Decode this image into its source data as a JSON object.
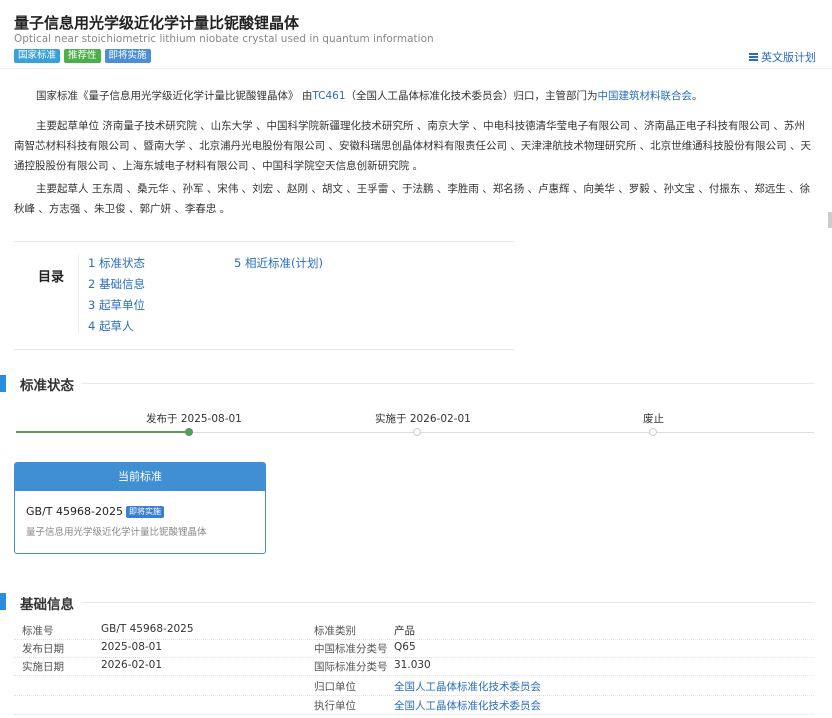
{
  "header": {
    "title_cn": "量子信息用光学级近化学计量比铌酸锂晶体",
    "title_en": "Optical near stoichiometric lithium niobate crystal used in quantum information",
    "tags": [
      "国家标准",
      "推荐性",
      "即将实施"
    ],
    "en_plan_label": "英文版计划"
  },
  "intro": {
    "p1_a": "国家标准《量子信息用光学级近化学计量比铌酸锂晶体》 由",
    "p1_tc": "TC461",
    "p1_b": "（全国人工晶体标准化技术委员会）归口，主管部门为",
    "p1_dept": "中国建筑材料联合会",
    "p1_c": "。",
    "p2": "主要起草单位 济南量子技术研究院 、山东大学 、中国科学院新疆理化技术研究所 、南京大学 、中电科技德清华莹电子有限公司 、济南晶正电子科技有限公司 、苏州南智芯材料科技有限公司 、暨南大学 、北京浦丹光电股份有限公司 、安徽科瑞思创晶体材料有限责任公司 、天津津航技术物理研究所 、北京世维通科技股份有限公司 、天通控股股份有限公司 、上海东城电子材料有限公司 、中国科学院空天信息创新研究院 。",
    "p3": "主要起草人 王东周 、桑元华 、孙军 、宋伟 、刘宏 、赵刚 、胡文 、王孚雷 、于法鹏 、李胜雨 、郑名扬 、卢惠辉 、向美华 、罗毅 、孙文宝 、付振东 、郑远生 、徐秋峰 、方志强 、朱卫俊 、郭广妍 、李春忠 。"
  },
  "toc": {
    "label": "目录",
    "items": [
      "1 标准状态",
      "2 基础信息",
      "3 起草单位",
      "4 起草人",
      "5 相近标准(计划)"
    ]
  },
  "status_section": {
    "title": "标准状态",
    "stages": [
      "发布于 2025-08-01",
      "实施于 2026-02-01",
      "废止"
    ],
    "card": {
      "header": "当前标准",
      "code": "GB/T 45968-2025",
      "badge": "即将实施",
      "name": "量子信息用光学级近化学计量比铌酸锂晶体"
    }
  },
  "basic_section": {
    "title": "基础信息",
    "left": [
      {
        "label": "标准号",
        "value": "GB/T 45968-2025"
      },
      {
        "label": "发布日期",
        "value": "2025-08-01"
      },
      {
        "label": "实施日期",
        "value": "2026-02-01"
      }
    ],
    "right": [
      {
        "label": "标准类别",
        "value": "产品"
      },
      {
        "label": "中国标准分类号",
        "value": "Q65"
      },
      {
        "label": "国际标准分类号",
        "value": "31.030"
      },
      {
        "label": "归口单位",
        "value": "全国人工晶体标准化技术委员会"
      },
      {
        "label": "执行单位",
        "value": "全国人工晶体标准化技术委员会"
      }
    ]
  },
  "colors": {
    "accent": "#2a8ee0",
    "link": "#2a6ebb",
    "done": "#5a9a5a"
  }
}
